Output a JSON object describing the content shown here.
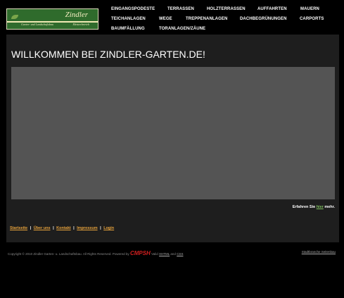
{
  "logo": {
    "name": "Zindler",
    "sub_left": "Garten- und Landschaftsbau",
    "sub_right": "Meisterbetrieb"
  },
  "nav": {
    "items": [
      "EINGANGSPODESTE",
      "TERRASSEN",
      "HOLZTERRASSEN",
      "AUFFAHRTEN",
      "MAUERN",
      "TEICHANLAGEN",
      "WEGE",
      "TREPPENANLAGEN",
      "DACHBEGRÜNUNGEN",
      "CARPORTS",
      "BAUMFÄLLUNG",
      "TORANLAGEN/ZÄUNE"
    ]
  },
  "main": {
    "title": "WILLKOMMEN BEI ZINDLER-GARTEN.DE!",
    "more_prefix": "Erfahren Sie",
    "more_link": "hier",
    "more_suffix": "mehr."
  },
  "footer": {
    "links": [
      "Startseite",
      "Über uns",
      "Kontakt",
      "Impressum",
      "Login"
    ],
    "separator": "|",
    "copyright": "Copyright © 2010 Zindler Garten- u. Landschaftsbau. All Rights Reserved. Powered by",
    "brand": "CMPSH",
    "valid": "Valid",
    "html": "XHTML",
    "and": "and",
    "css": "CSS",
    "sitemap": "Stadtbranche Seitenbau"
  },
  "colors": {
    "background": "#000000",
    "content": "#1e1e1e",
    "panel": "#545454",
    "link_orange": "#e8a33c",
    "link_green": "#7fbf5e",
    "brand_red": "#d21f1f"
  }
}
